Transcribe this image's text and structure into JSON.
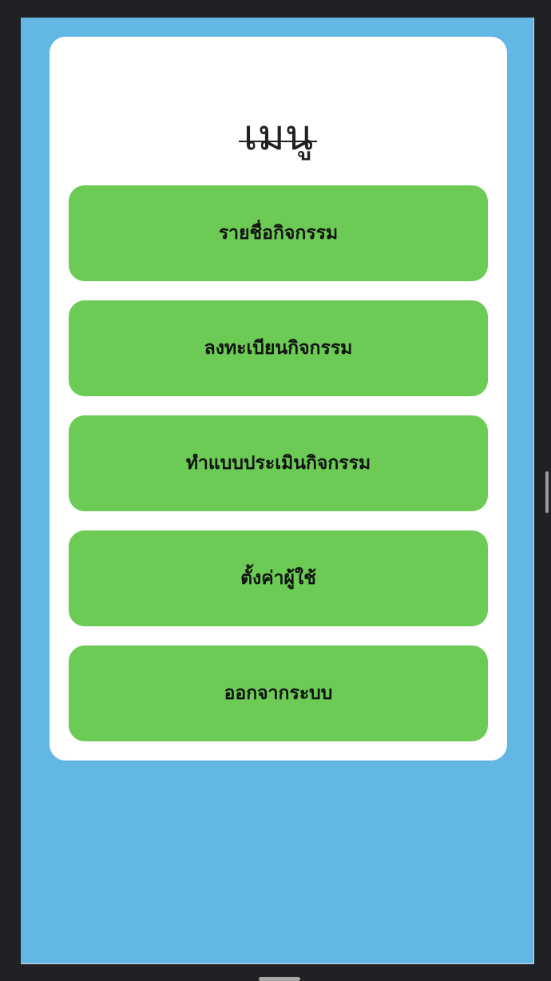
{
  "app": {
    "title": "เมนู"
  },
  "menu": {
    "items": [
      {
        "label": "รายชื่อกิจกรรม"
      },
      {
        "label": "ลงทะเบียนกิจกรรม"
      },
      {
        "label": "ทำแบบประเมินกิจกรรม"
      },
      {
        "label": "ตั้งค่าผู้ใช้"
      },
      {
        "label": "ออกจากระบบ"
      }
    ]
  },
  "colors": {
    "background": "#62b7e5",
    "card": "#ffffff",
    "button": "#6ccb55",
    "text": "#111111",
    "title": "#202124"
  }
}
